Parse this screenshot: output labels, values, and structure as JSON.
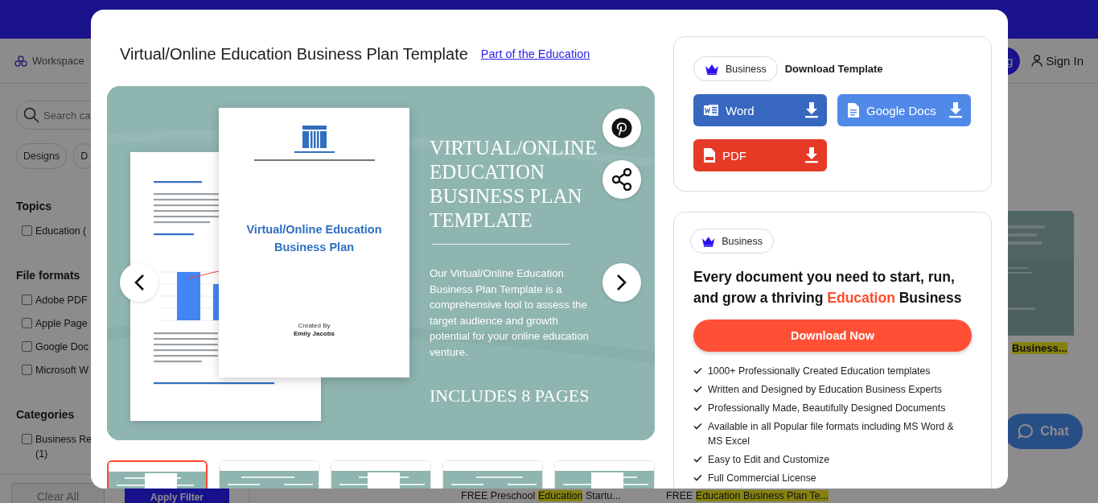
{
  "site": {
    "workspace": "Workspace",
    "signup_partial": "g",
    "sign_in": "Sign In"
  },
  "filters": {
    "search_placeholder": "Search ca",
    "chips": [
      "Designs",
      "D"
    ],
    "groups": [
      {
        "title": "Topics",
        "options": [
          {
            "label": "Education (",
            "checked": false
          }
        ]
      },
      {
        "title": "File formats",
        "options": [
          {
            "label": "Adobe PDF",
            "checked": false
          },
          {
            "label": "Apple Page",
            "checked": false
          },
          {
            "label": "Google Doc",
            "checked": false
          },
          {
            "label": "Microsoft W",
            "checked": false
          }
        ]
      },
      {
        "title": "Categories",
        "options": [
          {
            "label": "Business Re (1)",
            "checked": false
          }
        ]
      }
    ],
    "clear": "Clear All",
    "apply": "Apply Filter"
  },
  "side_result": {
    "title": [
      {
        "text": "Business...",
        "highlight": true
      }
    ]
  },
  "bottom_results": [
    {
      "title": [
        {
          "text": "FREE Preschool ",
          "highlight": false
        },
        {
          "text": "Education",
          "highlight": true
        },
        {
          "text": " Startu...",
          "highlight": false
        }
      ]
    },
    {
      "title": [
        {
          "text": "FREE ",
          "highlight": false
        },
        {
          "text": "Education Business Plan Te...",
          "highlight": true
        }
      ]
    }
  ],
  "chat": "Chat",
  "modal": {
    "title": "Virtual/Online Education Business Plan Template",
    "link": "Part of the Education",
    "preview": {
      "heading": "VIRTUAL/ONLINE EDUCATION BUSINESS PLAN TEMPLATE",
      "description": "Our Virtual/Online Education Business Plan Template is a comprehensive tool to assess the target audience and growth potential for your online education venture.",
      "pages_note": "INCLUDES 8 PAGES",
      "cover": {
        "title": "Virtual/Online Education Business Plan",
        "created_label": "Created By",
        "author": "Emily Jacobs"
      }
    },
    "thumbnails": [
      {
        "selected": true
      },
      {
        "selected": false
      },
      {
        "selected": false
      },
      {
        "selected": false
      },
      {
        "selected": false
      }
    ],
    "download": {
      "badge": "Business",
      "title": "Download Template",
      "formats": [
        {
          "kind": "word",
          "label": "Word"
        },
        {
          "kind": "gdocs",
          "label": "Google Docs"
        },
        {
          "kind": "pdf",
          "label": "PDF"
        }
      ]
    },
    "promo": {
      "badge": "Business",
      "headline": "Every document you need to start, run, and grow a thriving **Education** Business",
      "cta": "Download Now",
      "features": [
        "1000+ Professionally Created Education templates",
        "Written and Designed by Education Business Experts",
        "Professionally Made, Beautifully Designed Documents",
        "Available in all Popular file formats including MS Word & MS Excel",
        "Easy to Edit and Customize",
        "Full Commercial License"
      ]
    }
  }
}
